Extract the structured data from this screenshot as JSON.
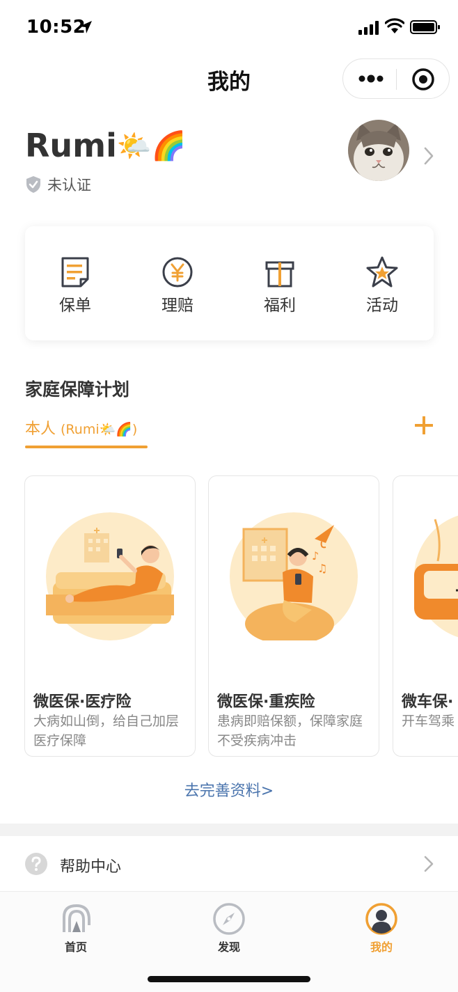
{
  "status_bar": {
    "time": "10:52"
  },
  "nav": {
    "title": "我的"
  },
  "profile": {
    "name": "Rumi",
    "name_emoji": "🌤️🌈",
    "verify_status": "未认证"
  },
  "shortcuts": [
    {
      "label": "保单",
      "icon": "policy-doc-icon"
    },
    {
      "label": "理赔",
      "icon": "yuan-coin-icon"
    },
    {
      "label": "福利",
      "icon": "gift-icon"
    },
    {
      "label": "活动",
      "icon": "star-icon"
    }
  ],
  "family_plan": {
    "title": "家庭保障计划",
    "tab_label": "本人",
    "tab_sub": "(Rumi🌤️🌈)",
    "cards": [
      {
        "title": "微医保·医疗险",
        "desc": "大病如山倒，给自己加层医疗保障"
      },
      {
        "title": "微医保·重疾险",
        "desc": "患病即赔保额，保障家庭不受疾病冲击"
      },
      {
        "title": "微车保·",
        "desc": "开车驾乘"
      }
    ],
    "complete_link": "去完善资料>"
  },
  "help": {
    "label": "帮助中心"
  },
  "tabbar": {
    "items": [
      {
        "label": "首页",
        "icon": "home-logo-icon"
      },
      {
        "label": "发现",
        "icon": "compass-icon"
      },
      {
        "label": "我的",
        "icon": "user-icon",
        "active": true
      }
    ]
  },
  "colors": {
    "accent": "#f0a033",
    "link": "#4a74ad",
    "illustration_bg": "#fdebc8"
  }
}
